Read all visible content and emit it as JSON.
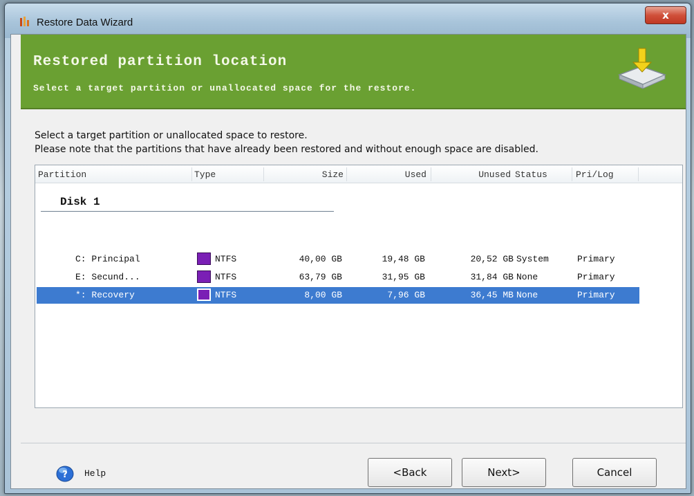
{
  "window": {
    "title": "Restore Data Wizard",
    "close_label": "x"
  },
  "header": {
    "title": "Restored partition location",
    "subtitle": "Select a target partition or unallocated space for the restore."
  },
  "instructions": {
    "line1": "Select a target partition or unallocated space to restore.",
    "line2": "Please note that the partitions that have already been restored and without enough space are disabled."
  },
  "table": {
    "columns": {
      "partition": "Partition",
      "type": "Type",
      "size": "Size",
      "used": "Used",
      "unused": "Unused",
      "status": "Status",
      "prilog": "Pri/Log"
    },
    "disk_label": "Disk 1",
    "rows": [
      {
        "partition": "C: Principal",
        "type": "NTFS",
        "size": "40,00 GB",
        "used": "19,48 GB",
        "unused": "20,52 GB",
        "status": "System",
        "prilog": "Primary"
      },
      {
        "partition": "E: Secund...",
        "type": "NTFS",
        "size": "63,79 GB",
        "used": "31,95 GB",
        "unused": "31,84 GB",
        "status": "None",
        "prilog": "Primary"
      },
      {
        "partition": "*: Recovery",
        "type": "NTFS",
        "size": "8,00 GB",
        "used": "7,96 GB",
        "unused": "36,45 MB",
        "status": "None",
        "prilog": "Primary"
      }
    ],
    "selected_row": 3,
    "ntfs_color": "#7a1fb5",
    "selection_color": "#3d7bd0"
  },
  "footer": {
    "help_label": "Help",
    "back_label": "<Back",
    "next_label": "Next>",
    "cancel_label": "Cancel"
  },
  "colors": {
    "header_bg": "#6aa032",
    "header_text": "#f4f8e8"
  },
  "icons": {
    "window": "restore-wizard-icon",
    "header": "disk-download-icon",
    "help": "help-globe-icon"
  }
}
